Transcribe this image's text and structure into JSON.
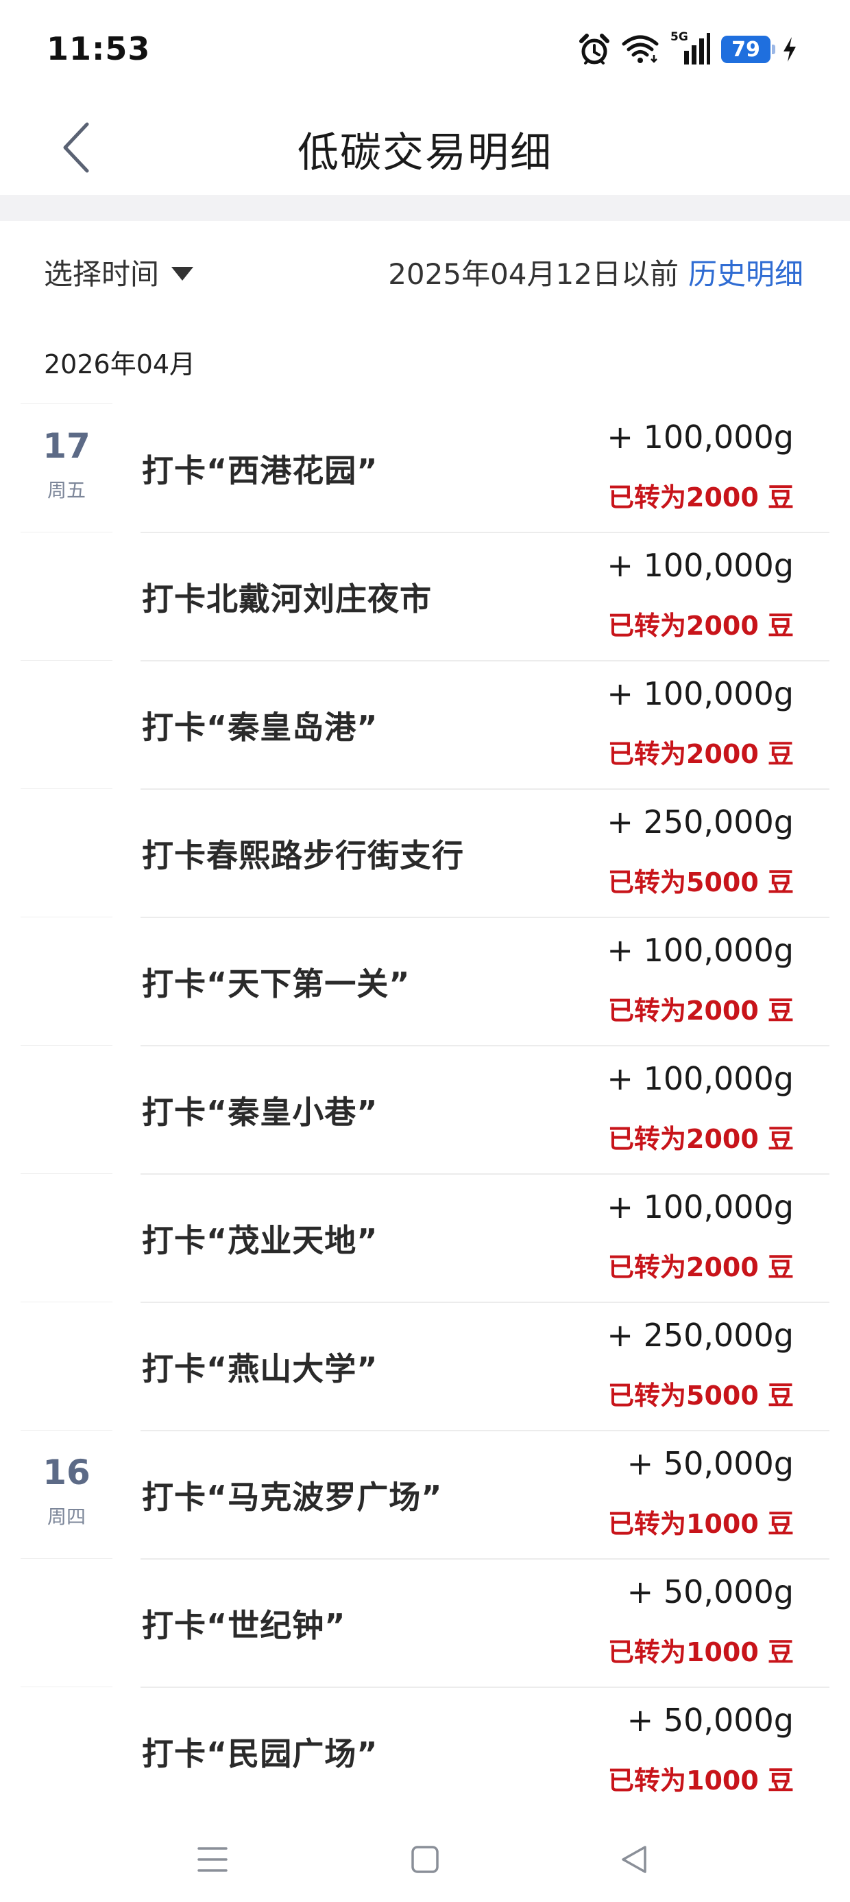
{
  "status_bar": {
    "time": "11:53",
    "network": "5G",
    "battery": "79",
    "icons": [
      "alarm-icon",
      "wifi-icon",
      "signal-icon",
      "battery-icon",
      "charging-icon"
    ]
  },
  "header": {
    "title": "低碳交易明细",
    "back_icon": "chevron-left-icon"
  },
  "filter": {
    "select_label": "选择时间",
    "before_text": "2025年04月12日以前",
    "history_link": "历史明细"
  },
  "month": "2026年04月",
  "colors": {
    "accent_blue": "#2f6cd3",
    "converted_red": "#c8141a",
    "date_color": "#5c6a86"
  },
  "transactions": [
    {
      "day": "17",
      "weekday": "周五",
      "title": "打卡“西港花园”",
      "amount": "+ 100,000g",
      "converted": "已转为2000 豆"
    },
    {
      "day": "",
      "weekday": "",
      "title": "打卡北戴河刘庄夜市",
      "amount": "+ 100,000g",
      "converted": "已转为2000 豆"
    },
    {
      "day": "",
      "weekday": "",
      "title": "打卡“秦皇岛港”",
      "amount": "+ 100,000g",
      "converted": "已转为2000 豆"
    },
    {
      "day": "",
      "weekday": "",
      "title": "打卡春熙路步行街支行",
      "amount": "+ 250,000g",
      "converted": "已转为5000 豆"
    },
    {
      "day": "",
      "weekday": "",
      "title": "打卡“天下第一关”",
      "amount": "+ 100,000g",
      "converted": "已转为2000 豆"
    },
    {
      "day": "",
      "weekday": "",
      "title": "打卡“秦皇小巷”",
      "amount": "+ 100,000g",
      "converted": "已转为2000 豆"
    },
    {
      "day": "",
      "weekday": "",
      "title": "打卡“茂业天地”",
      "amount": "+ 100,000g",
      "converted": "已转为2000 豆"
    },
    {
      "day": "",
      "weekday": "",
      "title": "打卡“燕山大学”",
      "amount": "+ 250,000g",
      "converted": "已转为5000 豆"
    },
    {
      "day": "16",
      "weekday": "周四",
      "title": "打卡“马克波罗广场”",
      "amount": "+ 50,000g",
      "converted": "已转为1000 豆"
    },
    {
      "day": "",
      "weekday": "",
      "title": "打卡“世纪钟”",
      "amount": "+ 50,000g",
      "converted": "已转为1000 豆"
    },
    {
      "day": "",
      "weekday": "",
      "title": "打卡“民园广场”",
      "amount": "+ 50,000g",
      "converted": "已转为1000 豆"
    }
  ],
  "nav": {
    "menu_icon": "menu-icon",
    "home_icon": "home-square-icon",
    "back_icon": "back-triangle-icon"
  }
}
